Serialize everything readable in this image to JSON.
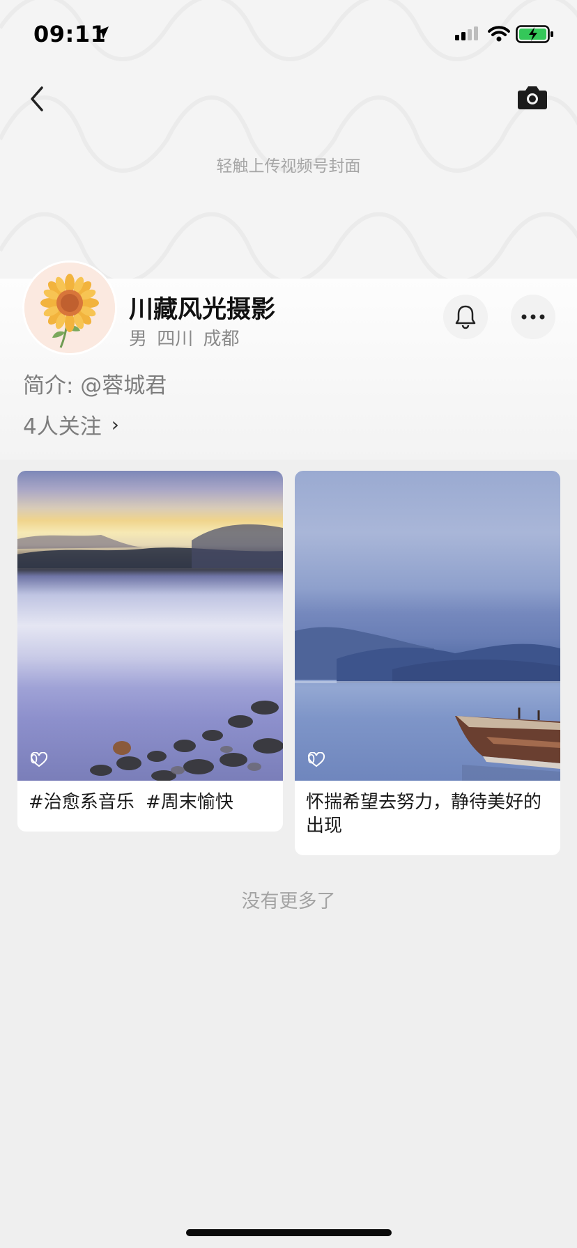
{
  "status_bar": {
    "time": "09:11"
  },
  "cover": {
    "hint": "轻触上传视频号封面"
  },
  "profile": {
    "name": "川藏风光摄影",
    "gender": "男",
    "location": "四川 成都",
    "bio": "简介: @蓉城君",
    "following": "4人关注"
  },
  "posts": [
    {
      "caption": "#治愈系音乐  #周末愉快",
      "likes": "0"
    },
    {
      "caption": "怀揣希望去努力，静待美好的出现",
      "likes": "0"
    }
  ],
  "footer": {
    "end_text": "没有更多了"
  },
  "colors": {
    "background": "#efefef",
    "hint_text": "#a6a6a6",
    "secondary_text": "#7d7d7d"
  }
}
